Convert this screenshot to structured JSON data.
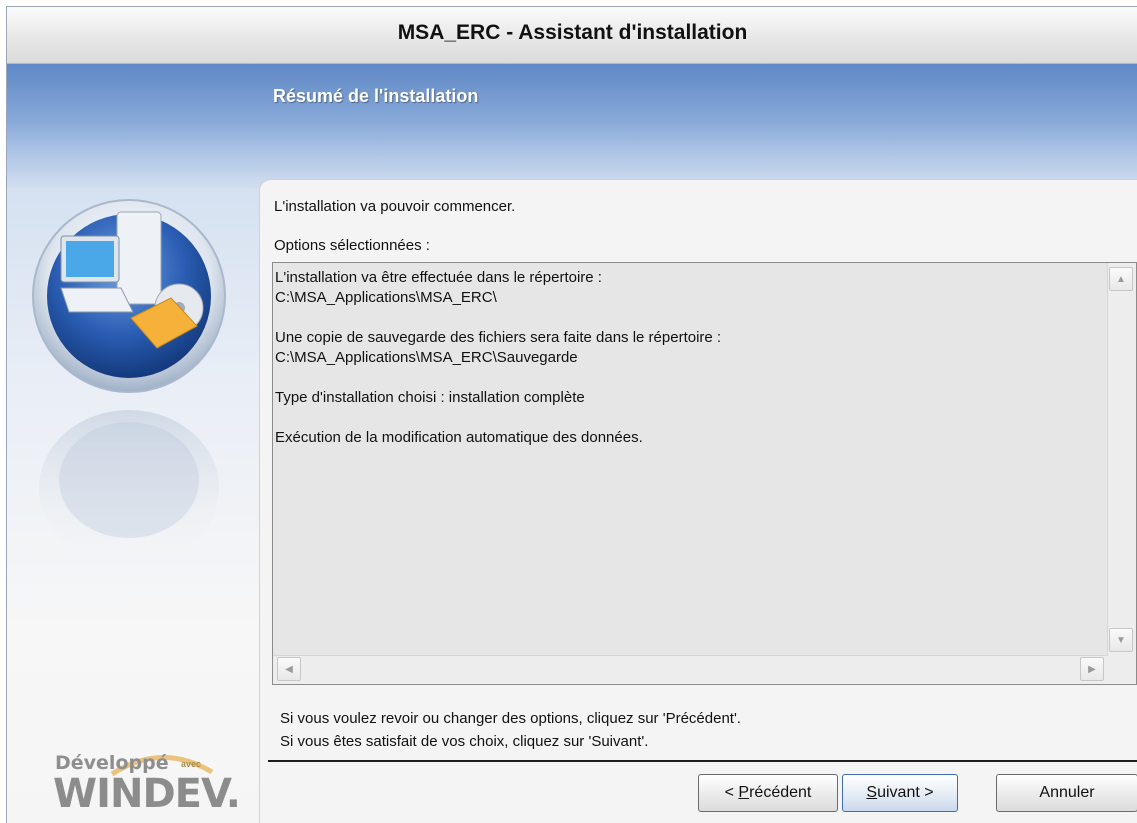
{
  "window": {
    "title": "MSA_ERC - Assistant d'installation"
  },
  "header": {
    "heading": "Résumé de l'installation"
  },
  "branding": {
    "line1": "Développé",
    "line1_small": "avec",
    "line2": "WINDEV."
  },
  "content": {
    "intro": "L'installation va pouvoir commencer.",
    "options_label": "Options sélectionnées :",
    "summary_lines": [
      "L'installation va être effectuée dans le répertoire :",
      "C:\\MSA_Applications\\MSA_ERC\\",
      "",
      "Une copie de sauvegarde des fichiers sera faite dans le répertoire :",
      "C:\\MSA_Applications\\MSA_ERC\\Sauvegarde",
      "",
      "Type d'installation choisi : installation complète",
      "",
      "Exécution de la modification automatique des données."
    ],
    "hint_line1": "Si vous voulez revoir ou changer des options, cliquez sur 'Précédent'.",
    "hint_line2": "Si vous êtes satisfait de vos choix, cliquez sur 'Suivant'."
  },
  "buttons": {
    "previous_prefix": "< ",
    "previous_accel": "P",
    "previous_rest": "récédent",
    "next_accel": "S",
    "next_rest": "uivant >",
    "cancel": "Annuler"
  },
  "colors": {
    "header_blue": "#6f95cf",
    "default_button_border": "#3f6ea8"
  }
}
